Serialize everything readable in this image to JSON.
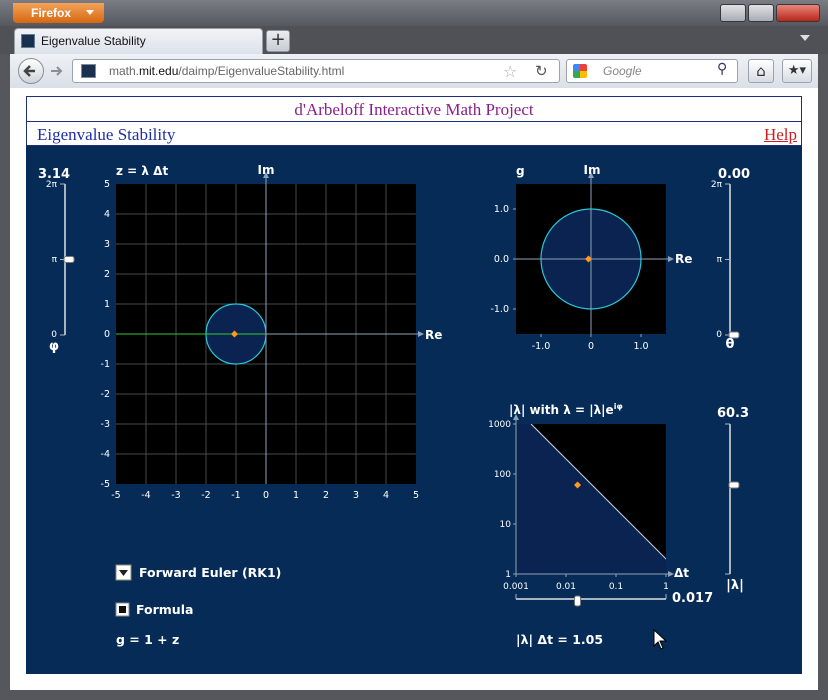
{
  "browser": {
    "app_button": "Firefox",
    "tab_title": "Eigenvalue Stability",
    "newtab_label": "+",
    "url_domain_prefix": "math.",
    "url_domain": "mit.edu",
    "url_path": "/daimp/EigenvalueStability.html",
    "search_placeholder": "Google"
  },
  "page": {
    "project_title": "d'Arbeloff Interactive Math Project",
    "app_title": "Eigenvalue Stability",
    "help_label": "Help"
  },
  "applet": {
    "phi_value": "3.14",
    "phi_label": "φ",
    "phi_ticks": [
      "2π",
      "π",
      "0"
    ],
    "phi": 3.14,
    "z_plot_title": "z = λ Δt",
    "z_plot": {
      "xlim": [
        -5,
        5
      ],
      "ylim": [
        -5,
        5
      ],
      "x_ticks": [
        "-5",
        "-4",
        "-3",
        "-2",
        "-1",
        "0",
        "1",
        "2",
        "3",
        "4",
        "5"
      ],
      "y_ticks": [
        "5",
        "4",
        "3",
        "2",
        "1",
        "0",
        "-1",
        "-2",
        "-3",
        "-4",
        "-5"
      ],
      "axis_re": "Re",
      "axis_im": "Im",
      "stability_circle": {
        "center": [
          -1,
          0
        ],
        "radius": 1
      },
      "eigen_point": [
        -1.05,
        0
      ]
    },
    "g_plot_title": "g",
    "g_plot": {
      "xlim": [
        -1.5,
        1.5
      ],
      "ylim": [
        -1.5,
        1.5
      ],
      "x_ticks": [
        "-1.0",
        "0",
        "1.0"
      ],
      "y_ticks": [
        "1.0",
        "0.0",
        "-1.0"
      ],
      "axis_re": "Re",
      "axis_im": "Im",
      "unit_circle": {
        "center": [
          0,
          0
        ],
        "radius": 1
      },
      "g_point": [
        -0.05,
        0
      ]
    },
    "theta_value": "0.00",
    "theta_label": "θ",
    "theta_ticks": [
      "2π",
      "π",
      "0"
    ],
    "theta": 0.0,
    "lambda_plot_title": "|λ| with λ = |λ|e",
    "lambda_plot_exp": "iφ",
    "lambda_plot": {
      "log_x": true,
      "log_y": true,
      "xlim": [
        0.001,
        1
      ],
      "ylim": [
        1,
        1000
      ],
      "x_ticks": [
        "0.001",
        "0.01",
        "0.1",
        "1"
      ],
      "y_ticks": [
        "1000",
        "100",
        "10",
        "1"
      ],
      "axis_dt": "Δt",
      "boundary_product": 2,
      "point": [
        0.017,
        60.3
      ]
    },
    "lambda_value": "60.3",
    "lambda_label": "|λ|",
    "dt_value": "0.017",
    "method_label": "Forward Euler (RK1)",
    "formula_label": "Formula",
    "formula_checked": true,
    "formula_text": "g = 1 + z",
    "lambda_dt_text": "|λ| Δt = 1.05"
  },
  "colors": {
    "app_bg": "#062b57",
    "plot_bg": "#000000",
    "stable_fill": "#0b2350",
    "circle": "#27c8d8",
    "point": "#ff9a1a",
    "grid": "#4a4a4a",
    "axis": "#8fa3b8",
    "title_purple": "#8a1f8a",
    "title_blue": "#1c2fa8",
    "help_red": "#cc1e1e"
  }
}
